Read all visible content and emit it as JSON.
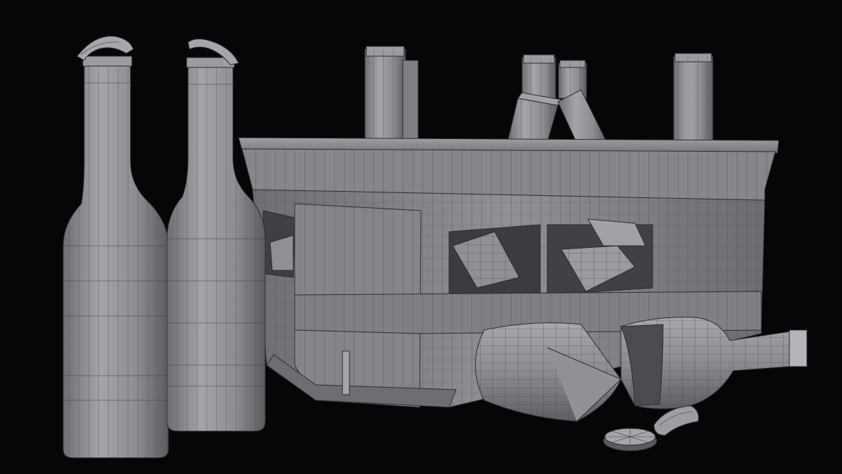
{
  "image": {
    "kind": "3d-wireframe-render",
    "colors": {
      "background": "#040608",
      "model_base": "#8b8d90",
      "model_shadow": "#55575a",
      "model_highlight": "#a7a9ac",
      "wire": "#3b3d40"
    }
  }
}
